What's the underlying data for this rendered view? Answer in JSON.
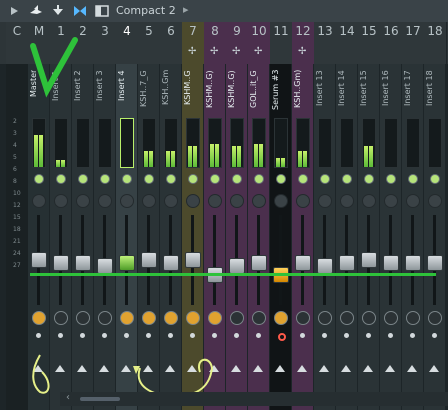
{
  "toolbar": {
    "preset_label": "Compact 2",
    "icons": [
      "play-icon",
      "bird-icon",
      "snap-icon",
      "arrows-icon",
      "window-icon",
      "chevron-right-icon"
    ]
  },
  "columns": [
    {
      "num": "C",
      "name": "",
      "kind": "ruler"
    },
    {
      "num": "M",
      "name": "Master",
      "kind": "master"
    },
    {
      "num": "1",
      "name": "Insert 1",
      "kind": "insert"
    },
    {
      "num": "2",
      "name": "Insert 2",
      "kind": "insert"
    },
    {
      "num": "3",
      "name": "Insert 3",
      "kind": "insert"
    },
    {
      "num": "4",
      "name": "Insert 4",
      "kind": "selected"
    },
    {
      "num": "5",
      "name": "KSH..7_G",
      "kind": "insert"
    },
    {
      "num": "6",
      "name": "KSH..Gm",
      "kind": "insert"
    },
    {
      "num": "7",
      "name": "KSHM..G",
      "kind": "yellow"
    },
    {
      "num": "8",
      "name": "KSHM..G)",
      "kind": "purple"
    },
    {
      "num": "9",
      "name": "KSHM..G)",
      "kind": "purple"
    },
    {
      "num": "10",
      "name": "GOL..it_G",
      "kind": "purple"
    },
    {
      "num": "11",
      "name": "Serum #3",
      "kind": "dark"
    },
    {
      "num": "12",
      "name": "KSH..Gm)",
      "kind": "purple"
    },
    {
      "num": "13",
      "name": "Insert 13",
      "kind": "insert"
    },
    {
      "num": "14",
      "name": "Insert 14",
      "kind": "insert"
    },
    {
      "num": "15",
      "name": "Insert 15",
      "kind": "insert"
    },
    {
      "num": "16",
      "name": "Insert 16",
      "kind": "insert"
    },
    {
      "num": "17",
      "name": "Insert 17",
      "kind": "insert"
    },
    {
      "num": "18",
      "name": "Insert 18",
      "kind": "insert"
    }
  ],
  "meter_levels": [
    0,
    0.7,
    0.15,
    0,
    0,
    0,
    0.35,
    0.35,
    0.45,
    0.5,
    0.45,
    0.5,
    0.2,
    0.35,
    0,
    0,
    0.45,
    0,
    0,
    0
  ],
  "fader_levels": [
    0,
    0.55,
    0.5,
    0.5,
    0.45,
    0.5,
    0.55,
    0.5,
    0.55,
    0.3,
    0.45,
    0.5,
    0.3,
    0.5,
    0.45,
    0.5,
    0.55,
    0.5,
    0.5,
    0.5
  ],
  "ruler_labels": [
    "2",
    "3",
    "4",
    "5",
    "6",
    "8",
    "10",
    "12",
    "15",
    "18",
    "21",
    "24",
    "27"
  ],
  "colors": {
    "yellow": "#4c4a2c",
    "purple": "#4b2f4d",
    "dark": "#101416",
    "selected": "#364145",
    "insert": "#2a3336",
    "master": "#263033",
    "accent": "#2ec23a"
  }
}
